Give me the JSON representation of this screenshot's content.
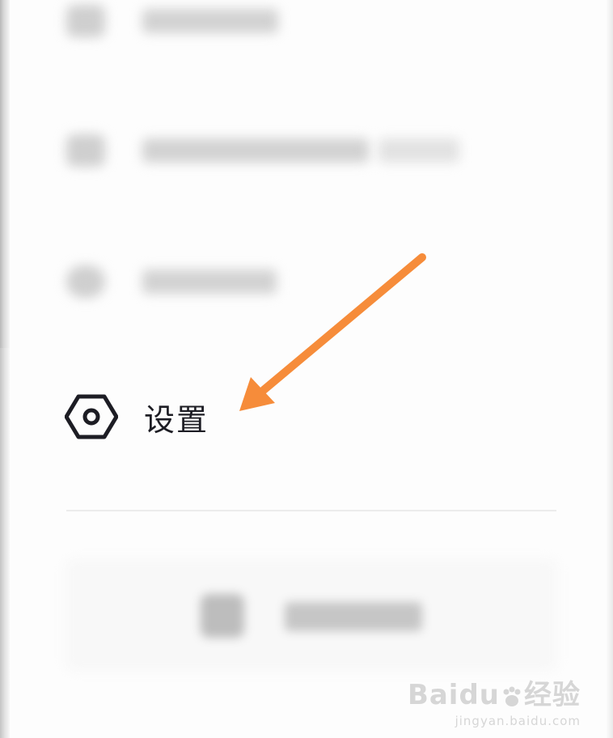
{
  "menu": {
    "settings_label": "设置",
    "settings_icon": "settings-hex-icon"
  },
  "annotation": {
    "arrow_color": "#f68c3a"
  },
  "watermark": {
    "brand": "Baidu",
    "brand_suffix": "经验",
    "url": "jingyan.baidu.com"
  },
  "colors": {
    "text": "#1d1d24",
    "divider": "#ececec",
    "background": "#fdfdfd"
  }
}
